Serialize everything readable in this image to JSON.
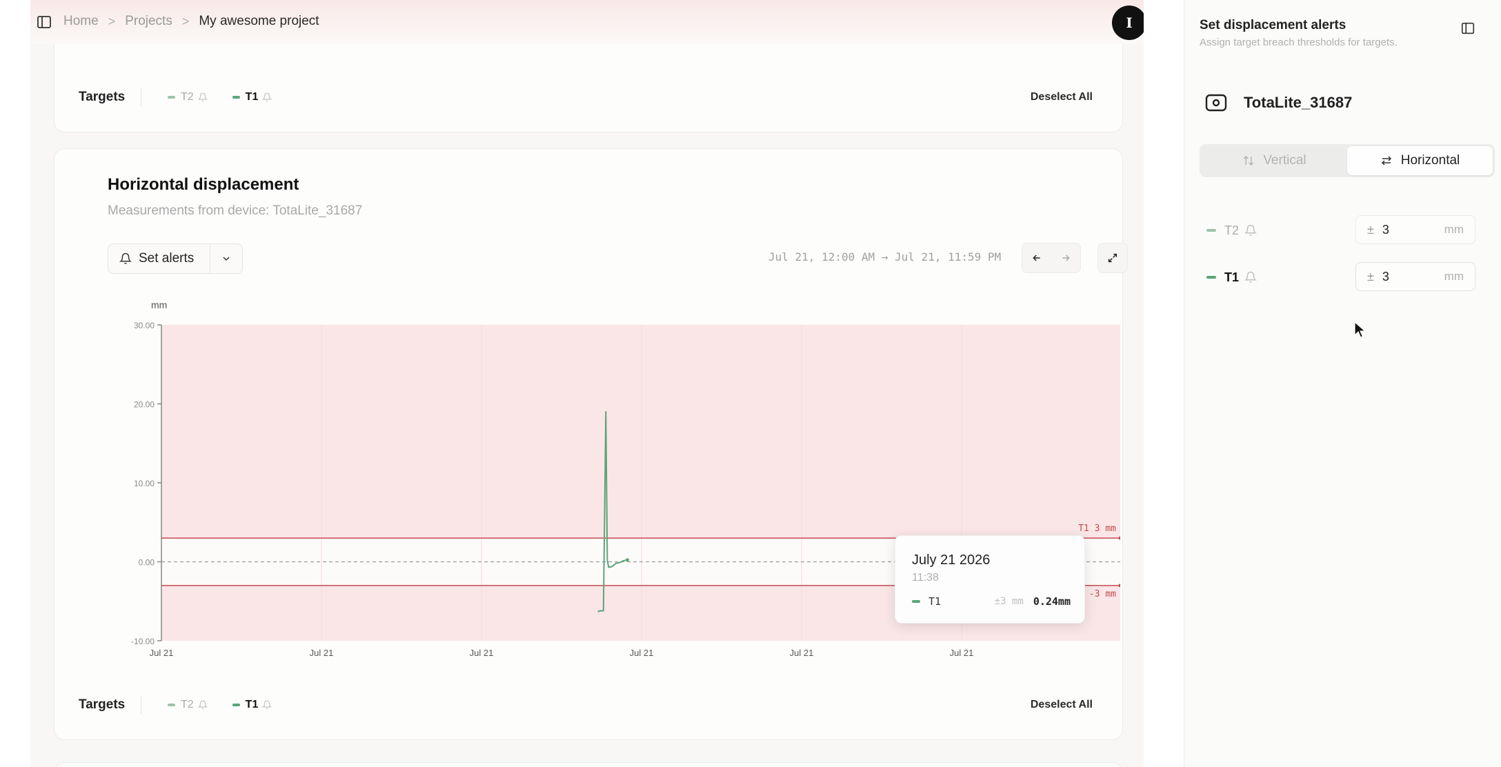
{
  "breadcrumb": {
    "items": [
      "Home",
      "Projects"
    ],
    "current": "My awesome project"
  },
  "avatar_initial": "I",
  "top_card": {
    "targets_label": "Targets",
    "targets": [
      {
        "name": "T2",
        "active": false,
        "color": "#7fb596"
      },
      {
        "name": "T1",
        "active": true,
        "color": "#5ba579"
      }
    ],
    "deselect_label": "Deselect All"
  },
  "chart_card": {
    "title": "Horizontal displacement",
    "subtitle": "Measurements from device: TotaLite_31687",
    "set_alerts_label": "Set alerts",
    "date_range": "Jul 21, 12:00 AM → Jul 21, 11:59 PM",
    "targets_label": "Targets",
    "targets": [
      {
        "name": "T2",
        "active": false,
        "color": "#7fb596"
      },
      {
        "name": "T1",
        "active": true,
        "color": "#5ba579"
      }
    ],
    "deselect_label": "Deselect All",
    "tooltip": {
      "date": "July 21 2026",
      "time": "11:38",
      "target": "T1",
      "threshold": "±3 mm",
      "value": "0.24mm"
    }
  },
  "chart_data": {
    "type": "line",
    "ylabel": "mm",
    "ylim": [
      -10,
      30
    ],
    "yticks": [
      "30.00",
      "20.00",
      "10.00",
      "0.00",
      "-10.00"
    ],
    "x_tick_labels": [
      "Jul 21",
      "Jul 21",
      "Jul 21",
      "Jul 21",
      "Jul 21",
      "Jul 21"
    ],
    "threshold_labels": {
      "upper": "T1 3 mm",
      "lower": "-3 mm"
    },
    "thresholds": [
      3,
      -3
    ],
    "series": [
      {
        "name": "T1",
        "color": "#5ba579",
        "x": [
          0.455,
          0.458,
          0.461,
          0.4635,
          0.465,
          0.4665,
          0.47,
          0.474,
          0.478,
          0.482,
          0.486
        ],
        "y": [
          -6.3,
          -6.2,
          -6.2,
          19,
          0.2,
          -0.7,
          -0.6,
          -0.2,
          -0.1,
          0.15,
          0.24
        ]
      }
    ],
    "colors": {
      "alert_band": "#fae6e7",
      "threshold_line": "#c24b50",
      "zero_line": "#9a9a9a"
    }
  },
  "panel": {
    "title": "Set displacement alerts",
    "subtitle": "Assign target breach thresholds for targets.",
    "device_name": "TotaLite_31687",
    "modes": [
      "Vertical",
      "Horizontal"
    ],
    "selected_mode": "Horizontal",
    "rows": [
      {
        "name": "T2",
        "active": false,
        "color": "#7fb596",
        "value": "3",
        "unit": "mm",
        "prefix": "±"
      },
      {
        "name": "T1",
        "active": true,
        "color": "#5ba579",
        "value": "3",
        "unit": "mm",
        "prefix": "±"
      }
    ]
  }
}
